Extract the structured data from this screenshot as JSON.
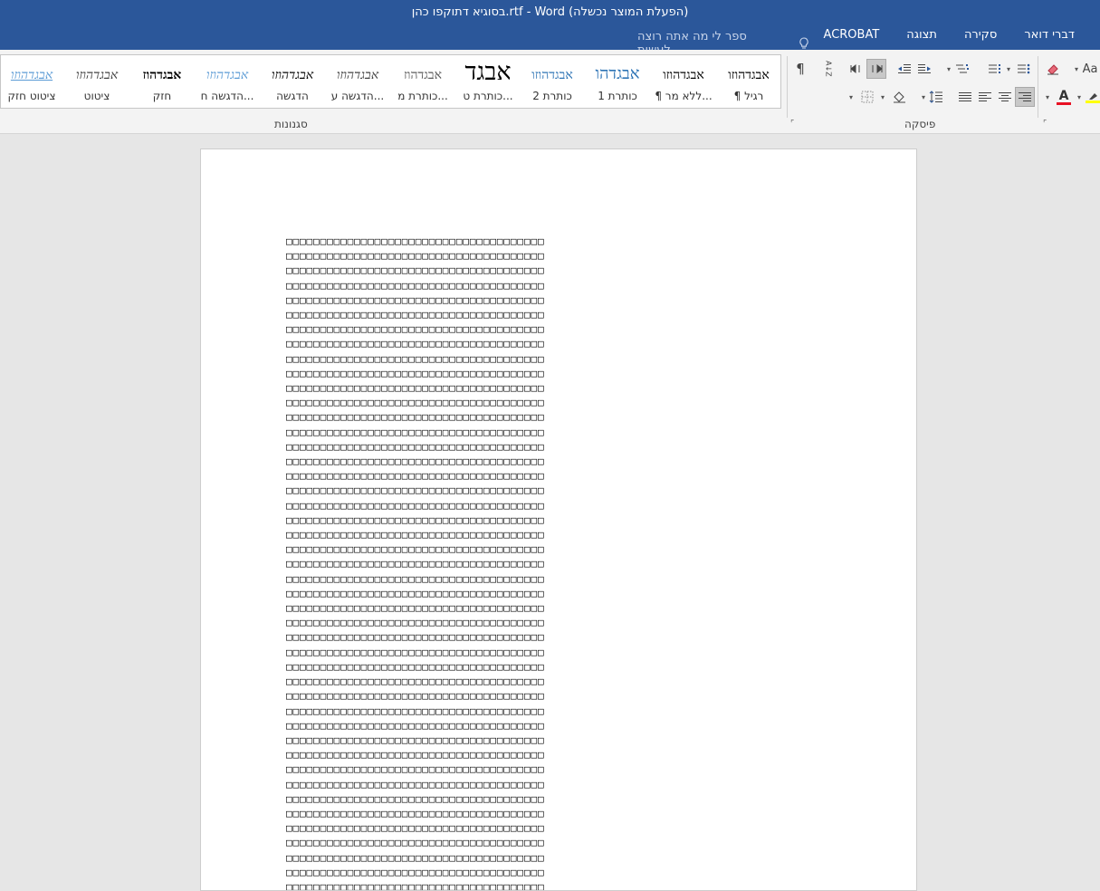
{
  "window": {
    "title": "בסוגיא דתוקפו כהן.rtf - Word (הפעלת המוצר נכשלה)"
  },
  "tabs": [
    "דברי דואר",
    "סקירה",
    "תצוגה",
    "ACROBAT"
  ],
  "tell_me": {
    "text": "ספר לי מה אתה רוצה לעשות..."
  },
  "groups": {
    "styles": "סגנונות",
    "paragraph": "פיסקה"
  },
  "styles_gallery": [
    {
      "preview": "אבגדהוזו",
      "name": "¶ רגיל"
    },
    {
      "preview": "אבגדהוזו",
      "name": "¶ ללא מר..."
    },
    {
      "preview": "אבגדהו",
      "name": "כותרת 1"
    },
    {
      "preview": "אבגדהוזו",
      "name": "כותרת 2"
    },
    {
      "preview": "אבגד",
      "name": "כותרת ט..."
    },
    {
      "preview": "אבגדהוז",
      "name": "כותרת מ..."
    },
    {
      "preview": "אבגדהוזו",
      "name": "הדגשה ע..."
    },
    {
      "preview": "אבגדהוזו",
      "name": "הדגשה"
    },
    {
      "preview": "אבגדהוזו",
      "name": "הדגשה ח..."
    },
    {
      "preview": "אבגדהוז",
      "name": "חזק"
    },
    {
      "preview": "אבגדהוזו",
      "name": "ציטוט"
    },
    {
      "preview": "אבגדהוזו",
      "name": "ציטוט חזק"
    }
  ],
  "font_group": {
    "change_case": "Aa",
    "font_color": "A"
  },
  "paragraph_buttons": {
    "show_marks": "¶",
    "sort": "A↓Z"
  },
  "document": {
    "line_count": 45,
    "glyphs_per_line": 38,
    "glyph": "□"
  },
  "colors": {
    "titlebar": "#2b579a",
    "font_color_bar": "#e81123",
    "highlight_bar": "#ffff00"
  }
}
